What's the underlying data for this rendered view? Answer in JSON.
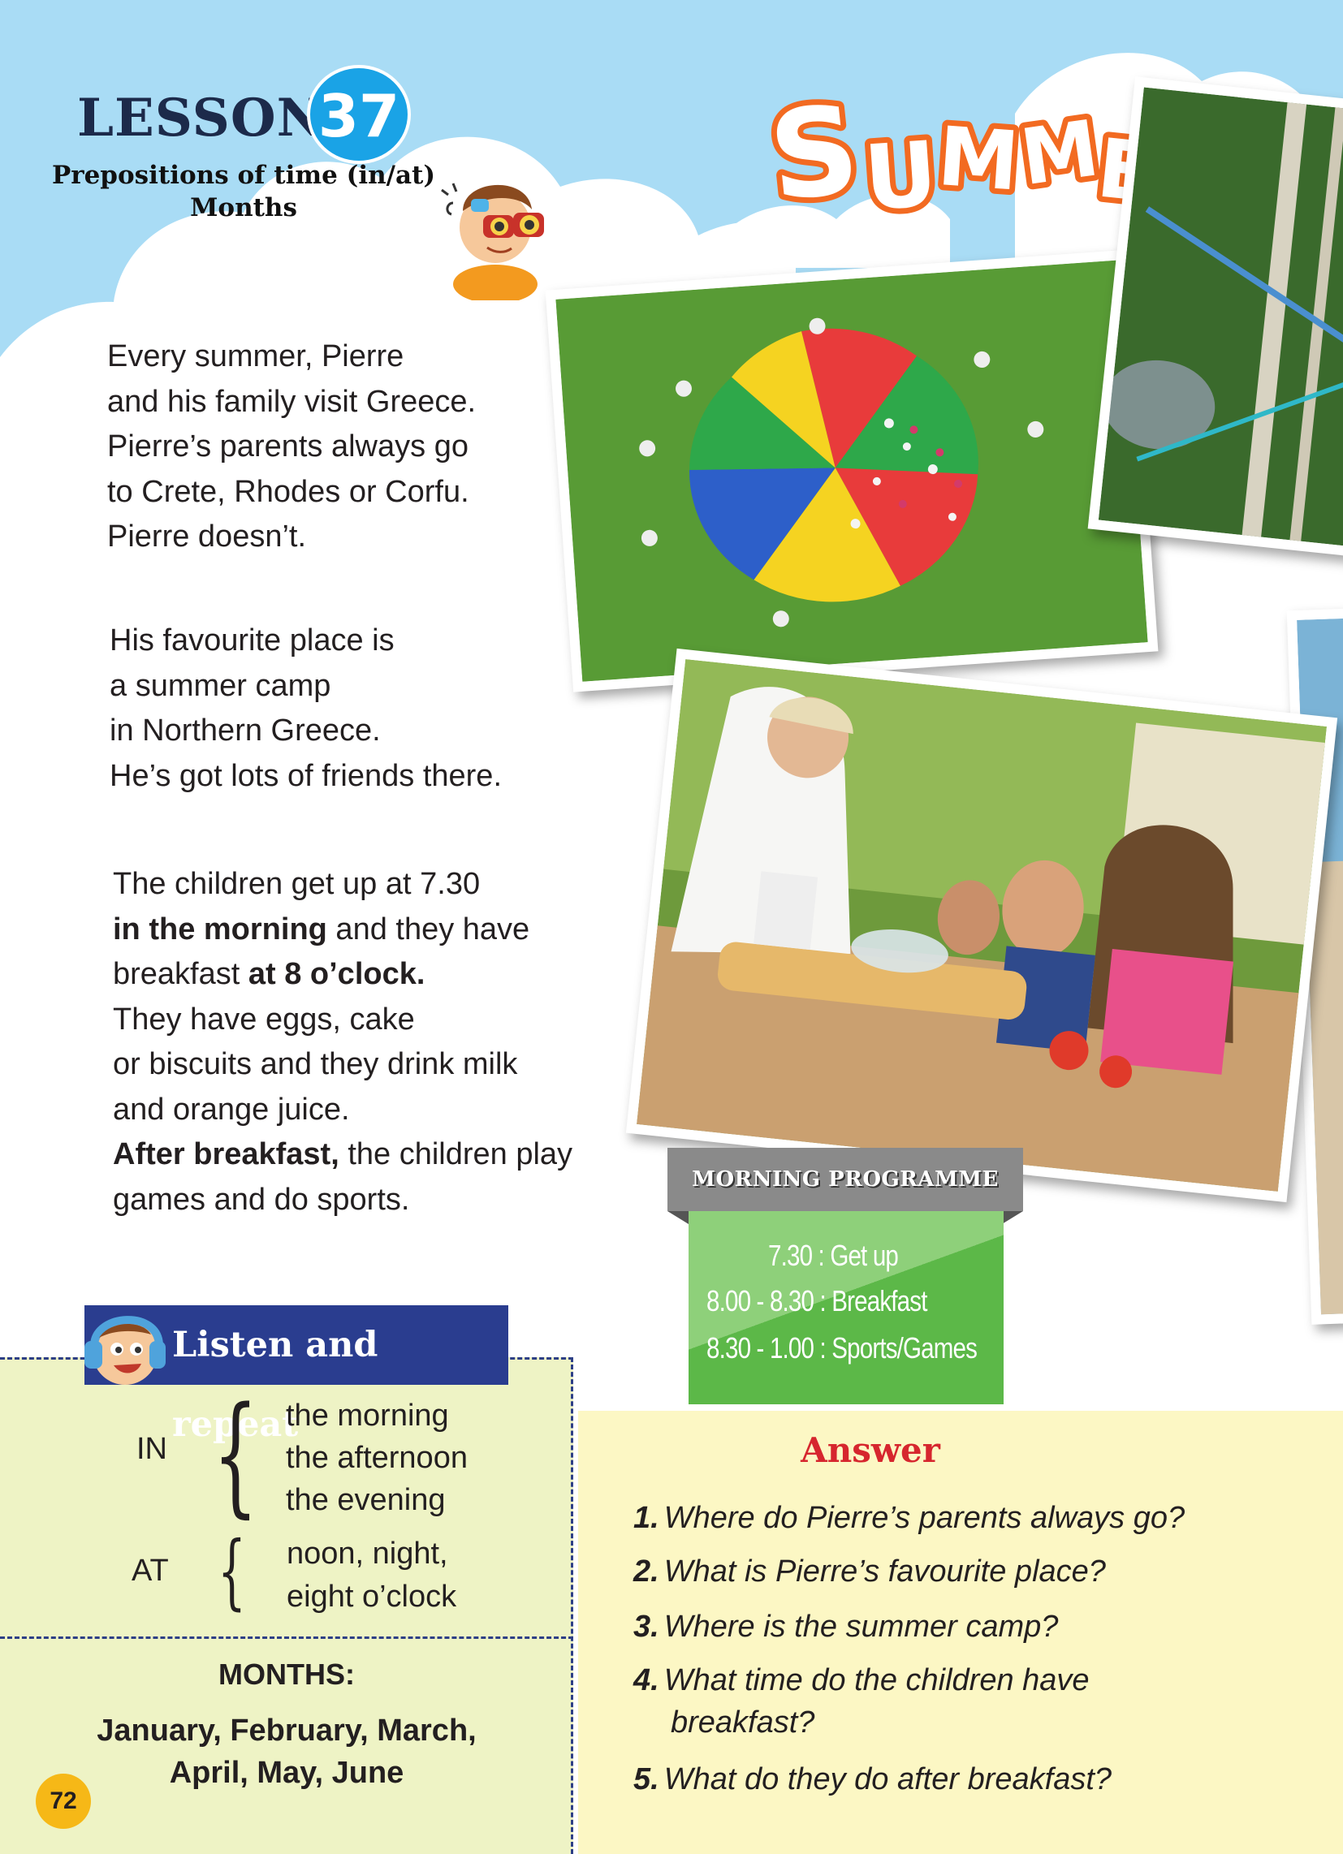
{
  "header": {
    "lesson_word": "LESSON",
    "lesson_number": "37",
    "subtitle_line1": "Prepositions of time  (in/at)",
    "subtitle_line2": "Months",
    "title_art": "SUMMER"
  },
  "reading": {
    "para1": [
      "Every summer, Pierre",
      "and his family visit Greece.",
      "Pierre’s parents always go",
      "to Crete, Rhodes or Corfu.",
      "Pierre doesn’t."
    ],
    "para2": [
      "His favourite place is",
      "a summer camp",
      "in Northern Greece.",
      "He’s got lots of friends there."
    ],
    "para3": {
      "l1": "The children get up at 7.30",
      "l2_bold": "in the morning",
      "l2_rest": " and they have",
      "l3_pre": "breakfast ",
      "l3_bold": "at 8 o’clock.",
      "l4": "They have eggs, cake",
      "l5": "or biscuits and they drink milk",
      "l6": "and orange juice.",
      "l7_bold": "After breakfast,",
      "l7_rest": " the children play",
      "l8": "games and do sports."
    }
  },
  "programme": {
    "heading": "MORNING PROGRAMME",
    "rows": [
      "7.30 : Get up",
      "8.00 - 8.30 : Breakfast",
      "8.30 - 1.00 : Sports/Games"
    ]
  },
  "listen": {
    "tab_label": "Listen and repeat",
    "in_label": "IN",
    "in_items": [
      "the morning",
      "the afternoon",
      "the evening"
    ],
    "at_label": "AT",
    "at_items": [
      "noon, night,",
      "eight o’clock"
    ],
    "months_heading": "MONTHS:",
    "months_line1": "January, February, March,",
    "months_line2": "April, May, June"
  },
  "answer": {
    "heading": "Answer",
    "questions": [
      {
        "n": "1.",
        "text": "Where do Pierre’s parents always go?"
      },
      {
        "n": "2.",
        "text": "What is Pierre’s favourite place?"
      },
      {
        "n": "3.",
        "text": "Where is the summer camp?"
      },
      {
        "n": "4.",
        "text": "What time do the children have",
        "text2": "breakfast?"
      },
      {
        "n": "5.",
        "text": "What do they do after breakfast?"
      }
    ]
  },
  "page_number": "72",
  "colors": {
    "sky": "#a9dcf5",
    "lesson_badge": "#1aa3e6",
    "title_orange": "#f26a21",
    "listen_tab": "#2a3d8f",
    "listen_bg": "#eef3c5",
    "answer_bg": "#fcf7c4",
    "answer_heading": "#d6262e",
    "programme_green": "#5cb848",
    "page_badge": "#f6b817"
  }
}
